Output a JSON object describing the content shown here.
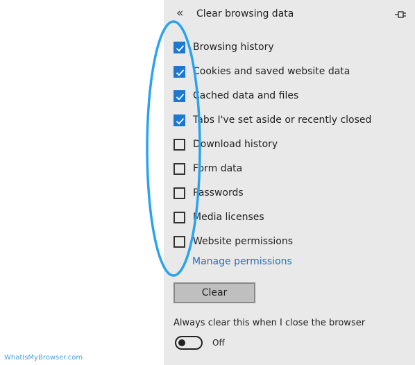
{
  "panel": {
    "title": "Clear browsing data",
    "back_icon": "double-chevron-left-icon",
    "pin_icon": "pin-icon",
    "options": [
      {
        "label": "Browsing history",
        "checked": true
      },
      {
        "label": "Cookies and saved website data",
        "checked": true
      },
      {
        "label": "Cached data and files",
        "checked": true
      },
      {
        "label": "Tabs I've set aside or recently closed",
        "checked": true
      },
      {
        "label": "Download history",
        "checked": false
      },
      {
        "label": "Form data",
        "checked": false
      },
      {
        "label": "Passwords",
        "checked": false
      },
      {
        "label": "Media licenses",
        "checked": false
      },
      {
        "label": "Website permissions",
        "checked": false
      }
    ],
    "manage_link": "Manage permissions",
    "clear_button": "Clear",
    "always_clear_label": "Always clear this when I close the browser",
    "toggle": {
      "state": "Off",
      "on": false
    }
  },
  "colors": {
    "checkbox_checked": "#1e78d0",
    "link": "#1e6fc9",
    "annotation": "#29a3ee"
  },
  "watermark": "WhatIsMyBrowser.com"
}
